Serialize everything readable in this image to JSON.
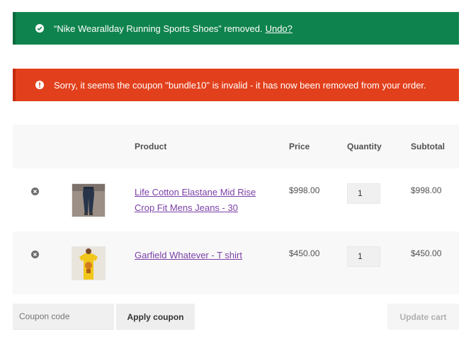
{
  "notices": {
    "success": {
      "icon": "check-circle-icon",
      "message": "“Nike Wearallday Running Sports Shoes” removed.",
      "undo_label": "Undo?"
    },
    "error": {
      "icon": "exclamation-circle-icon",
      "message": "Sorry, it seems the coupon \"bundle10\" is invalid - it has now been removed from your order."
    }
  },
  "table": {
    "columns": [
      "",
      "",
      "Product",
      "Price",
      "Quantity",
      "Subtotal"
    ],
    "rows": [
      {
        "product": "Life Cotton Elastane Mid Rise Crop Fit Mens Jeans - 30",
        "price": "$998.00",
        "quantity": "1",
        "subtotal": "$998.00",
        "thumb_icon": "jeans-thumbnail"
      },
      {
        "product": "Garfield Whatever - T shirt",
        "price": "$450.00",
        "quantity": "1",
        "subtotal": "$450.00",
        "thumb_icon": "tshirt-thumbnail"
      }
    ]
  },
  "actions": {
    "coupon_placeholder": "Coupon code",
    "apply_label": "Apply coupon",
    "update_label": "Update cart"
  },
  "colors": {
    "success": "#0f834d",
    "error": "#e2401c",
    "link": "#7b3fa8"
  }
}
